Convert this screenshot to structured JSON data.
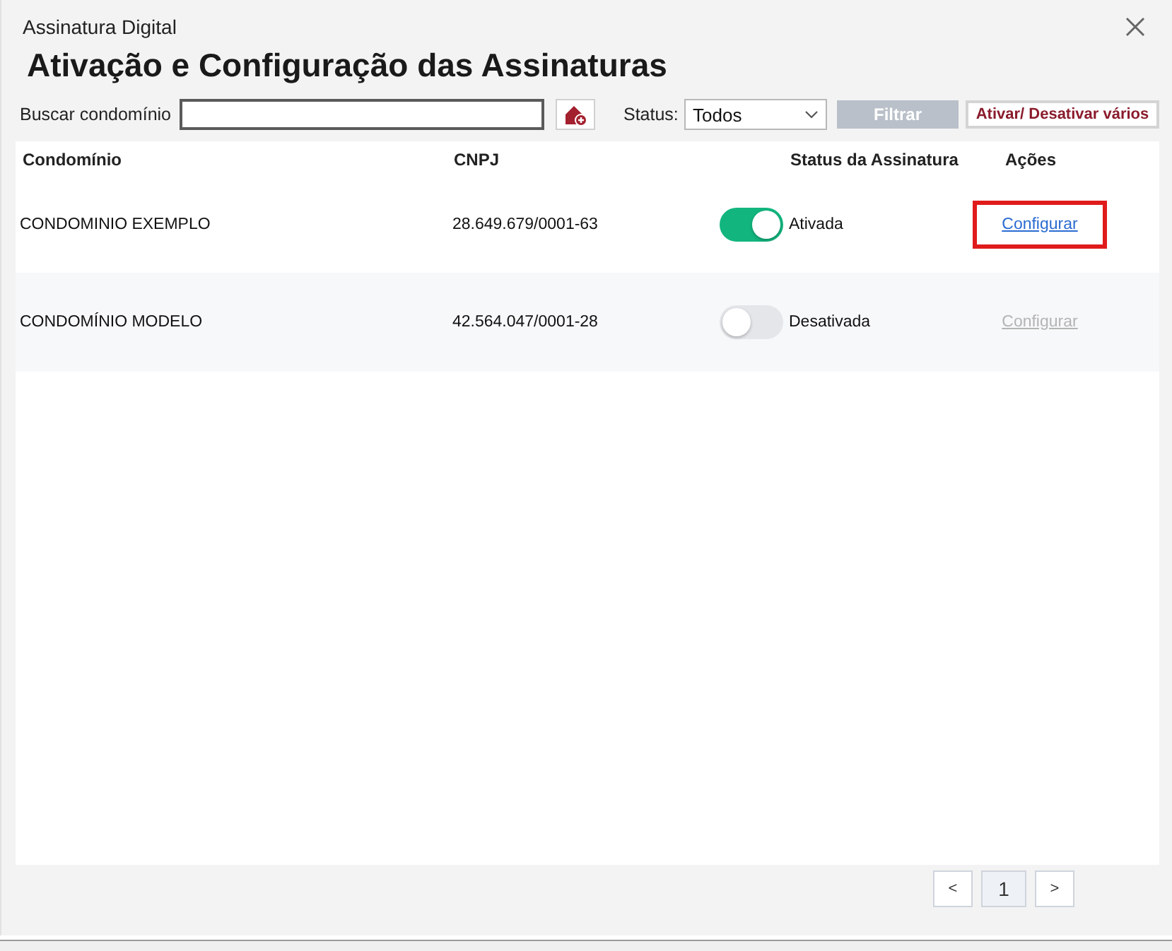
{
  "window": {
    "title": "Assinatura Digital"
  },
  "heading": "Ativação e Configuração das Assinaturas",
  "toolbar": {
    "search_label": "Buscar condomínio",
    "status_label": "Status:",
    "status_select": {
      "value": "Todos"
    },
    "buttons": [
      {
        "label": "Filtrar",
        "kind": "filled",
        "disabled": true
      },
      {
        "label": "Ativar/ Desativar vários",
        "kind": "outline",
        "disabled": false
      }
    ]
  },
  "table": {
    "columns": [
      "Condomínio",
      "CNPJ",
      "Status da Assinatura",
      "Ações"
    ],
    "rows": [
      {
        "name": "CONDOMINIO EXEMPLO",
        "cnpj": "28.649.679/0001-63",
        "active": true,
        "status": "Ativada",
        "action": {
          "label": "Configurar",
          "disabled": false,
          "highlighted": true
        }
      },
      {
        "name": "CONDOMÍNIO MODELO",
        "cnpj": "42.564.047/0001-28",
        "active": false,
        "status": "Desativada",
        "action": {
          "label": "Configurar",
          "disabled": true,
          "highlighted": false
        }
      }
    ]
  },
  "pagination": {
    "prev": "<",
    "pages": [
      {
        "label": "1",
        "selected": true
      }
    ],
    "next": ">"
  }
}
